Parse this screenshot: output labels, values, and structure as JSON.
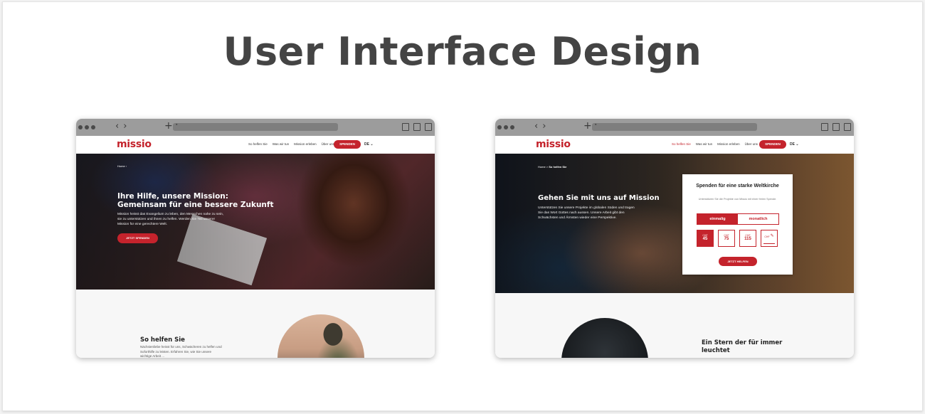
{
  "title": "User Interface Design",
  "left_window": {
    "logo": "missio",
    "menu": [
      "So helfen Sie",
      "Was wir tun",
      "Mission erleben",
      "Über uns"
    ],
    "donate_button": "SPENDEN",
    "lang": "DE",
    "breadcrumb": "Home",
    "hero_title": "Ihre Hilfe, unsere Mission: Gemeinsam für eine bessere Zukunft",
    "hero_text": "Mission heisst das Evangelium zu leben, den Menschen nahe zu sein, sie zu unterstützen und ihnen zu helfen. Werden Sie Teil unserer Mission für eine gerechtere Welt.",
    "hero_cta": "JETZT SPENDEN",
    "section_title": "So helfen Sie",
    "section_text": "Nächstenliebe heisst für uns, Schwächeren zu helfen und Soforthilfe zu leisten. Erfahren Sie, wie Sie unsere wichtige Arbeit ..."
  },
  "right_window": {
    "logo": "missio",
    "menu": [
      "So helfen Sie",
      "Was wir tun",
      "Mission erleben",
      "Über uns"
    ],
    "donate_button": "SPENDEN",
    "lang": "DE",
    "breadcrumb_home": "Home",
    "breadcrumb_sep": ">",
    "breadcrumb_current": "So helfen Sie",
    "hero_title": "Gehen Sie mit uns auf Mission",
    "hero_text": "Unterstützen Sie unsere Projekte im globalen Süden und tragen Sie das Wort Gottes nach aussen. Unsere Arbeit gibt den Schwächsten und Ärmsten wieder eine Perspektive.",
    "donation_box": {
      "title": "Spenden für eine starke Weltkirche",
      "subtitle": "Unterstützen Sie die Projekte von Missio mit einer freien Spende.",
      "freq_once": "einmalig",
      "freq_monthly": "monatlich",
      "currency": "CHF",
      "amounts": [
        "45",
        "75",
        "115"
      ],
      "custom_icon": "pencil-icon",
      "cta": "JETZT HELFEN"
    },
    "section_title": "Ein Stern der für immer leuchtet"
  },
  "colors": {
    "brand_red": "#c4232c",
    "title_gray": "#444444"
  }
}
